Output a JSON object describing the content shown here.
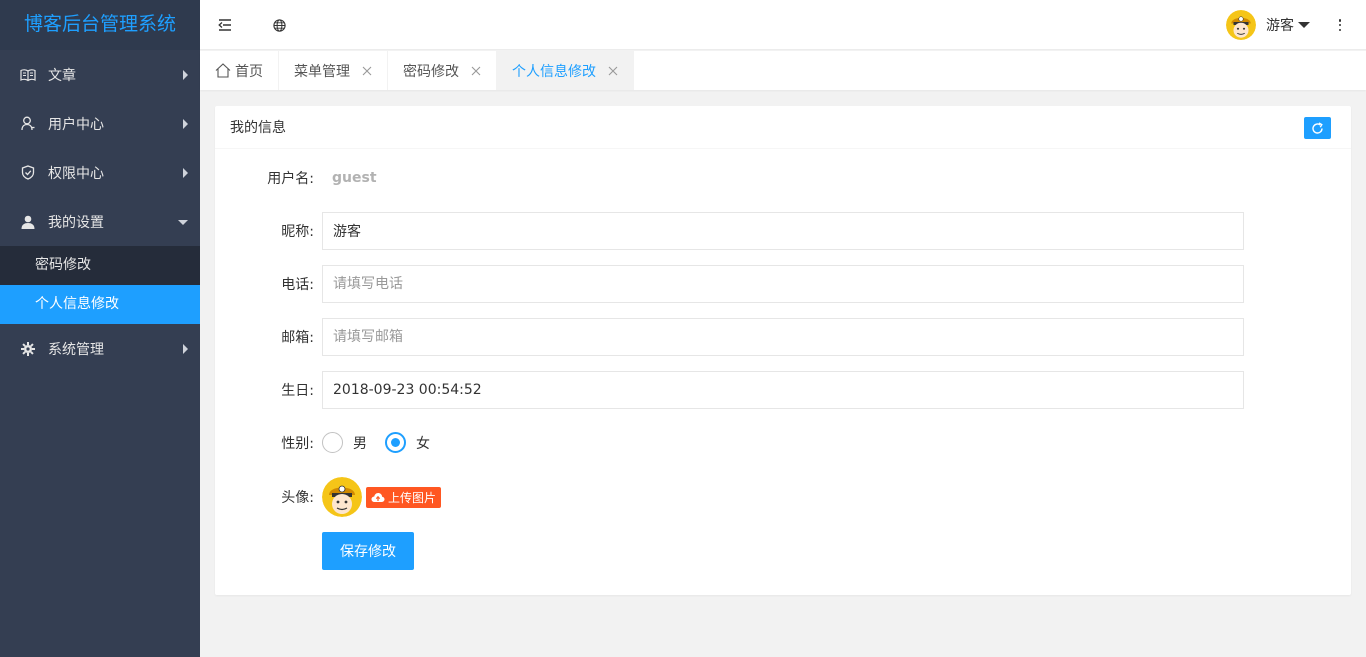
{
  "app": {
    "title": "博客后台管理系统"
  },
  "sidebar": {
    "items": [
      {
        "label": "文章",
        "icon": "book-icon"
      },
      {
        "label": "用户中心",
        "icon": "user-outline-icon"
      },
      {
        "label": "权限中心",
        "icon": "shield-icon"
      },
      {
        "label": "我的设置",
        "icon": "person-icon"
      },
      {
        "label": "系统管理",
        "icon": "gear-icon"
      }
    ],
    "submenu": [
      {
        "label": "密码修改"
      },
      {
        "label": "个人信息修改",
        "active": true
      }
    ]
  },
  "header": {
    "username": "游客"
  },
  "tabs": [
    {
      "label": "首页"
    },
    {
      "label": "菜单管理"
    },
    {
      "label": "密码修改"
    },
    {
      "label": "个人信息修改",
      "active": true
    }
  ],
  "card": {
    "title": "我的信息"
  },
  "form": {
    "username_label": "用户名:",
    "username_value": "guest",
    "nickname_label": "昵称:",
    "nickname_value": "游客",
    "phone_label": "电话:",
    "phone_placeholder": "请填写电话",
    "email_label": "邮箱:",
    "email_placeholder": "请填写邮箱",
    "birthday_label": "生日:",
    "birthday_value": "2018-09-23 00:54:52",
    "gender_label": "性别:",
    "gender_options": [
      "男",
      "女"
    ],
    "gender_selected": "女",
    "avatar_label": "头像:",
    "upload_label": "上传图片",
    "save_label": "保存修改"
  },
  "colors": {
    "accent": "#1e9fff",
    "sidebar_bg": "#343e52",
    "upload": "#ff5722"
  }
}
